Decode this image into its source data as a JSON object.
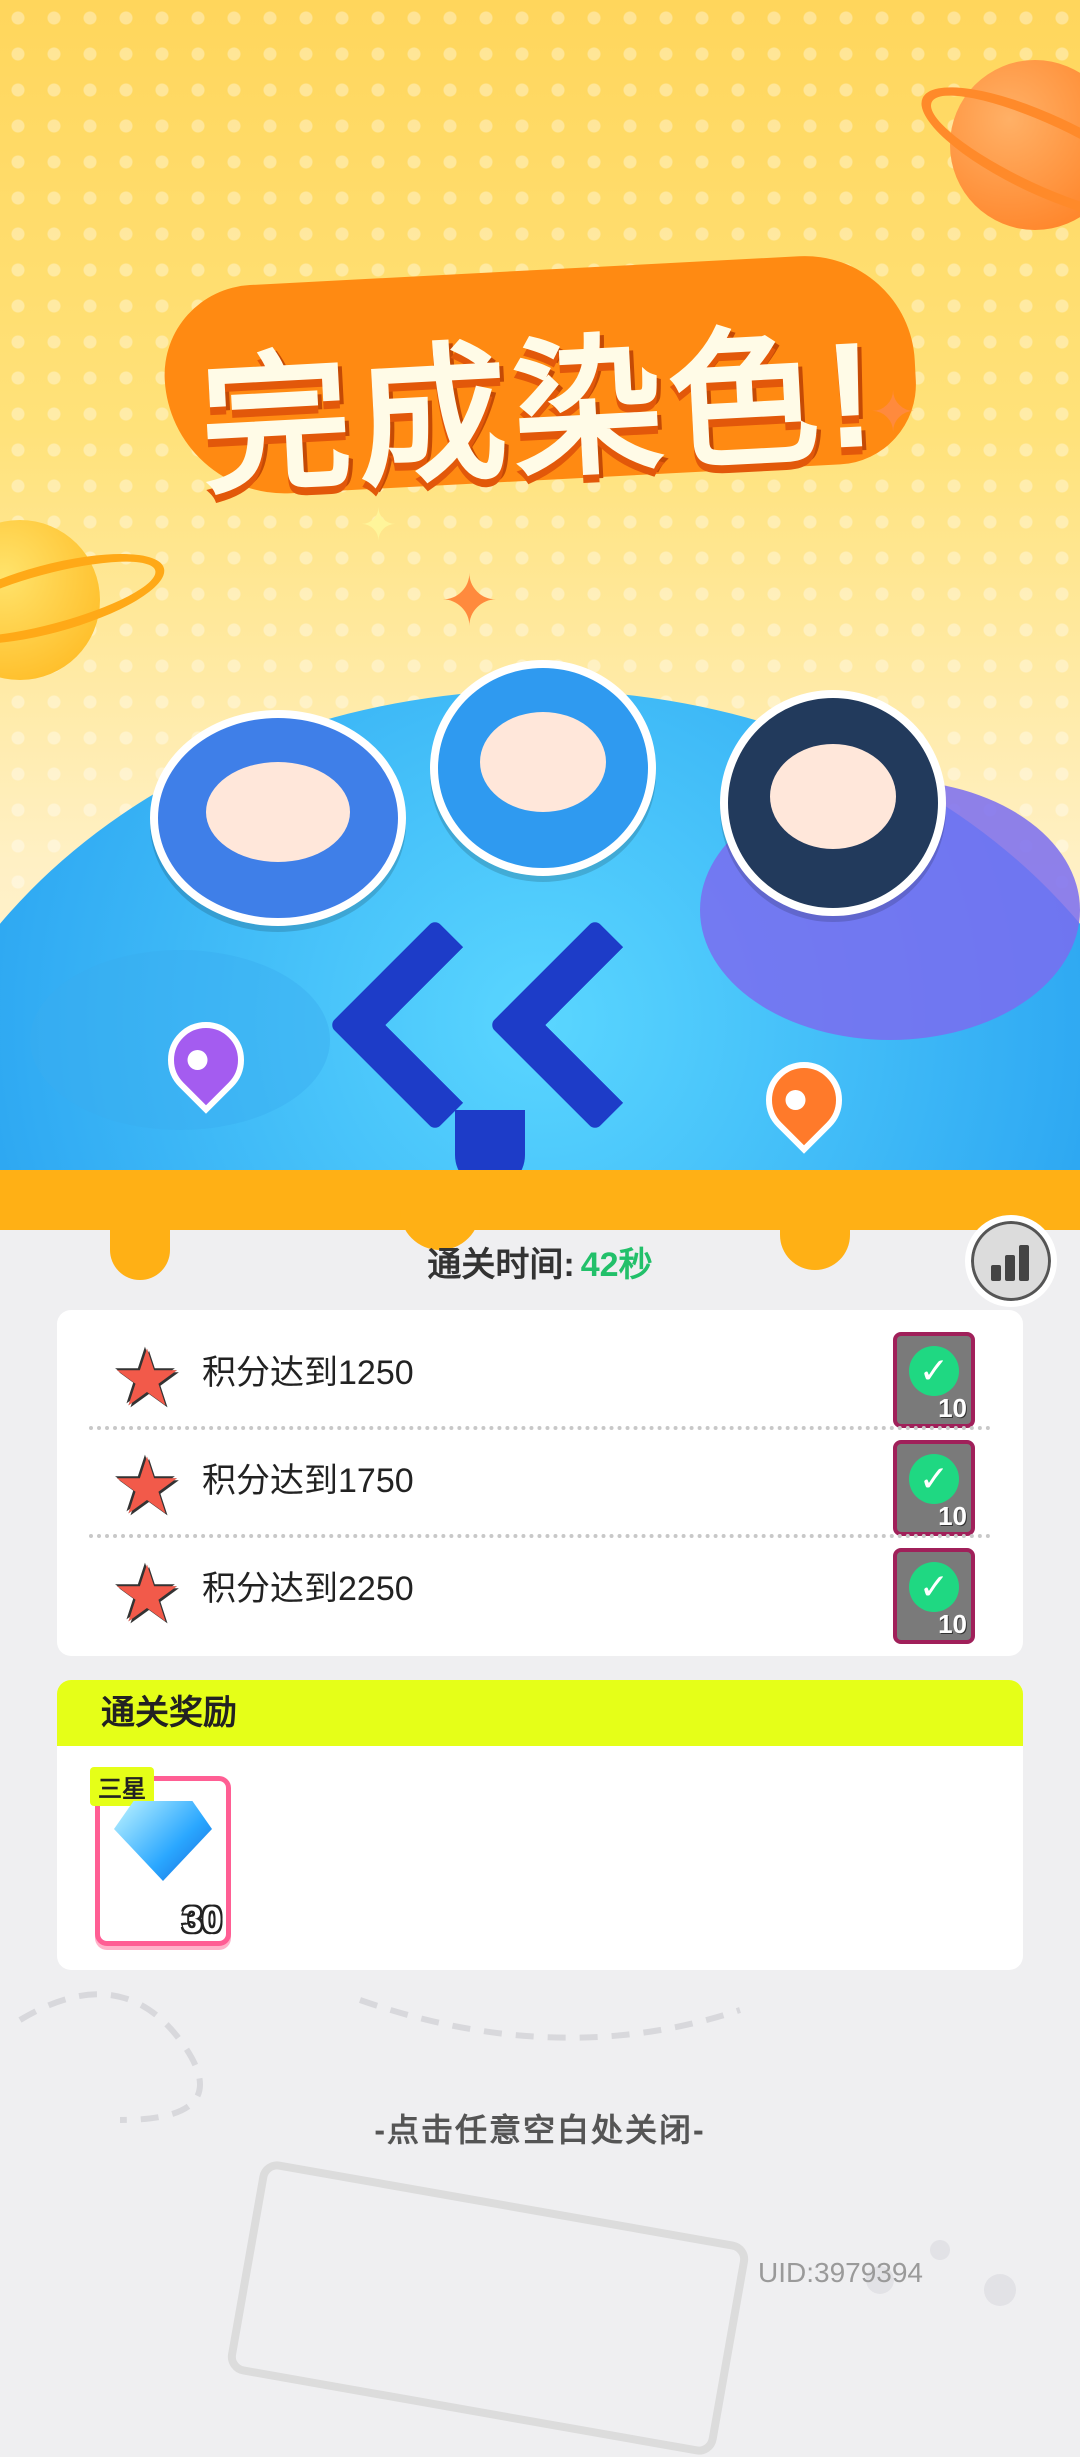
{
  "hero": {
    "title": "完成染色!"
  },
  "result": {
    "time_label": "通关时间:",
    "time_value": "42秒"
  },
  "missions": [
    {
      "label": "积分达到1250",
      "reward_count": "10",
      "completed": true
    },
    {
      "label": "积分达到1750",
      "reward_count": "10",
      "completed": true
    },
    {
      "label": "积分达到2250",
      "reward_count": "10",
      "completed": true
    }
  ],
  "reward": {
    "heading": "通关奖励",
    "item_tag": "三星",
    "item_icon": "blue-diamond-icon",
    "item_count": "30"
  },
  "footer": {
    "close_hint": "-点击任意空白处关闭-",
    "uid": "UID:3979394"
  },
  "colors": {
    "accent_green": "#22c06a",
    "reward_header": "#e5ff18",
    "title_orange": "#ff8a12"
  }
}
